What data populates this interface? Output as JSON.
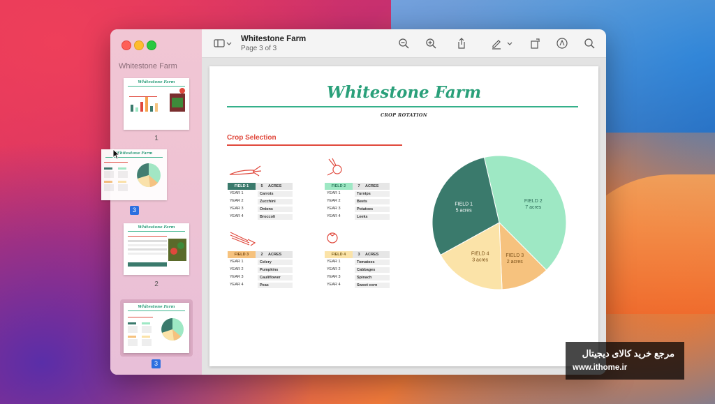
{
  "window": {
    "title": "Whitestone Farm",
    "subtitle": "Page 3 of 3"
  },
  "sidebar": {
    "title": "Whitestone Farm",
    "thumbnails": [
      {
        "title": "Whitestone Farm",
        "page_label": "1"
      },
      {
        "title": "Whitestone Farm",
        "page_label": "2"
      },
      {
        "title": "Whitestone Farm",
        "page_label": "3",
        "selected": true
      }
    ],
    "dragged_thumbnail": {
      "title": "Whitestone Farm",
      "page_label": "3"
    }
  },
  "toolbar": {
    "icons": [
      "sidebar-toggle-icon",
      "chevron-down-icon",
      "zoom-out-icon",
      "zoom-in-icon",
      "share-icon",
      "markup-pen-icon",
      "chevron-down-icon",
      "rotate-icon",
      "annotate-icon",
      "search-icon"
    ]
  },
  "document": {
    "title": "Whitestone Farm",
    "subtitle": "CROP ROTATION",
    "section_title": "Crop Selection",
    "fields": [
      {
        "name": "FIELD 1",
        "acres": "5",
        "acres_label": "ACRES",
        "color": "#3a7a6c",
        "text_color": "#ffffff",
        "icon": "carrot-icon",
        "rows": [
          {
            "year": "YEAR 1",
            "crop": "Carrots"
          },
          {
            "year": "YEAR 2",
            "crop": "Zucchini"
          },
          {
            "year": "YEAR 3",
            "crop": "Onions"
          },
          {
            "year": "YEAR 4",
            "crop": "Broccoli"
          }
        ]
      },
      {
        "name": "FIELD 2",
        "acres": "7",
        "acres_label": "ACRES",
        "color": "#9ee8c4",
        "text_color": "#2a7a5c",
        "icon": "turnip-icon",
        "rows": [
          {
            "year": "YEAR 1",
            "crop": "Turnips"
          },
          {
            "year": "YEAR 2",
            "crop": "Beets"
          },
          {
            "year": "YEAR 3",
            "crop": "Potatoes"
          },
          {
            "year": "YEAR 4",
            "crop": "Leeks"
          }
        ]
      },
      {
        "name": "FIELD 3",
        "acres": "2",
        "acres_label": "ACRES",
        "color": "#f6c27e",
        "text_color": "#7a4a12",
        "icon": "celery-icon",
        "rows": [
          {
            "year": "YEAR 1",
            "crop": "Celery"
          },
          {
            "year": "YEAR 2",
            "crop": "Pumpkins"
          },
          {
            "year": "YEAR 3",
            "crop": "Cauliflower"
          },
          {
            "year": "YEAR 4",
            "crop": "Peas"
          }
        ]
      },
      {
        "name": "FIELD 4",
        "acres": "3",
        "acres_label": "ACRES",
        "color": "#fbe3a8",
        "text_color": "#7a6020",
        "icon": "tomato-icon",
        "rows": [
          {
            "year": "YEAR 1",
            "crop": "Tomatoes"
          },
          {
            "year": "YEAR 2",
            "crop": "Cabbages"
          },
          {
            "year": "YEAR 3",
            "crop": "Spinach"
          },
          {
            "year": "YEAR 4",
            "crop": "Sweet corn"
          }
        ]
      }
    ]
  },
  "chart_data": {
    "type": "pie",
    "slices": [
      {
        "label": "FIELD 2",
        "sub": "7 acres",
        "value": 7,
        "color": "#9ee8c4"
      },
      {
        "label": "FIELD 3",
        "sub": "2 acres",
        "value": 2,
        "color": "#f6c27e"
      },
      {
        "label": "FIELD 4",
        "sub": "3 acres",
        "value": 3,
        "color": "#fbe3a8"
      },
      {
        "label": "FIELD 1",
        "sub": "5 acres",
        "value": 5,
        "color": "#3a7a6c"
      }
    ]
  },
  "watermark": {
    "line1": "مرجع خرید کالای دیجیتال",
    "line2": "www.ithome.ir"
  }
}
